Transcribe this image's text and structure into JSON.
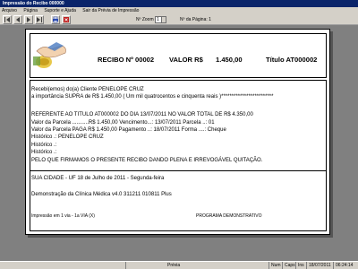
{
  "window": {
    "title": "Impressão do Recibo 000000"
  },
  "menu": [
    "Arquivo",
    "Página",
    "Suporte e Ajuda",
    "Sair da Prévia de Impressão"
  ],
  "toolbar": {
    "buttons": [
      {
        "name": "first-page",
        "color": "#404040"
      },
      {
        "name": "prev-page",
        "color": "#404040"
      },
      {
        "name": "next-page",
        "color": "#404040"
      },
      {
        "name": "last-page",
        "color": "#404040"
      },
      {
        "name": "print",
        "color": "#2a4ab0"
      },
      {
        "name": "close",
        "color": "#c02020"
      }
    ],
    "zoom_label": "Nº Zoom",
    "zoom_value": "1",
    "page_label": "Nº da Página: 1"
  },
  "receipt": {
    "title": "RECIBO Nº 00002",
    "valor_label": "VALOR R$",
    "valor": "1.450,00",
    "titulo": "Título AT000002",
    "line1": "Recebi(emos) do(a) Cliente PENELOPE CRUZ",
    "line2": "a importância SUPRA de R$     1.450,00  ( Um mil quatrocentos e cinquenta  reais )*************************",
    "ref_line": "REFERENTE AO TITULO  AT000002     DO DIA 13/07/2011    NO VALOR TOTAL DE R$          4.350,00",
    "parcela_line": "Valor da Parcela ...........R$        1.450,00    Vencimento...: 13/07/2011     Parcela ..: 01",
    "paga_line": "Valor da Parcela PAGA R$        1.450,00    Pagamento ..: 18/07/2011     Forma ....:  Cheque",
    "historico1": "Histórico .: PENELOPE CRUZ",
    "historico2": "Histórico .:",
    "historico3": "Histórico .:",
    "quitacao": "PELO QUE FIRMAMOS O PRESENTE RECIBO DANDO PLENA E IRREVOGÁVEL QUITAÇÃO.",
    "cidade": "SUA CIDADE - UF 18 de Julho de 2011 - Segunda-feira",
    "demo": "Demonstração da Clínica Médica v4.0 311211 010811 Plus",
    "footer_left": "Impressão em 1 via  -  1a VIA  (X)",
    "footer_right": "PROGRAMA DEMONSTRATIVO"
  },
  "status": {
    "center": "Prévia",
    "num": "Num",
    "caps": "Caps",
    "ins": "Ins",
    "date": "18/07/2011",
    "time": "06:24:14"
  }
}
